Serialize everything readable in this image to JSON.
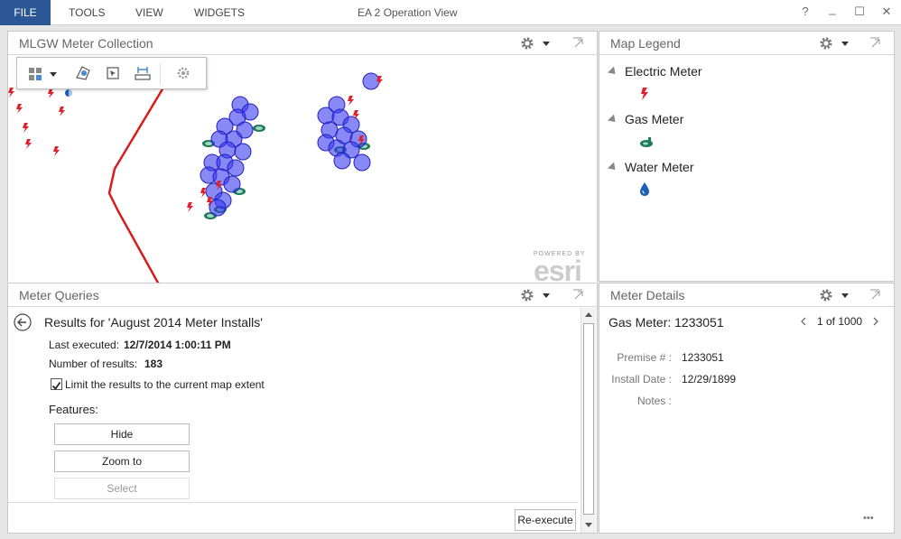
{
  "menu": {
    "file": "FILE",
    "tools": "TOOLS",
    "view": "VIEW",
    "widgets": "WIDGETS",
    "app_title": "EA 2 Operation View",
    "help": "?",
    "minimize": "_",
    "maximize": "☐",
    "close": "✕"
  },
  "map_panel": {
    "title": "MLGW Meter Collection",
    "esri_powered": "POWERED BY",
    "esri": "esri"
  },
  "legend_panel": {
    "title": "Map Legend",
    "items": [
      {
        "label": "Electric Meter",
        "icon": "lightning-icon"
      },
      {
        "label": "Gas Meter",
        "icon": "gas-meter-icon"
      },
      {
        "label": "Water Meter",
        "icon": "water-drop-icon"
      }
    ]
  },
  "queries_panel": {
    "title": "Meter Queries",
    "results_title": "Results for 'August 2014 Meter Installs'",
    "last_executed_label": "Last executed:",
    "last_executed_value": "12/7/2014 1:00:11 PM",
    "num_results_label": "Number of results:",
    "num_results_value": "183",
    "limit_label": "Limit the results to the current map extent",
    "limit_checked": true,
    "features_label": "Features:",
    "hide_button": "Hide",
    "zoom_button": "Zoom to",
    "select_button": "Select",
    "reexecute_button": "Re-execute"
  },
  "details_panel": {
    "title": "Meter Details",
    "heading": "Gas Meter: 1233051",
    "pager": "1 of 1000",
    "fields": [
      {
        "label": "Premise # :",
        "value": "1233051"
      },
      {
        "label": "Install Date :",
        "value": "12/29/1899"
      },
      {
        "label": "Notes :",
        "value": ""
      }
    ],
    "more": "•••"
  },
  "colors": {
    "accent": "#2b5797",
    "electric": "#e0202a",
    "gas": "#1f7a5a",
    "water": "#1a5fb4",
    "cluster": "#3a3af0"
  }
}
